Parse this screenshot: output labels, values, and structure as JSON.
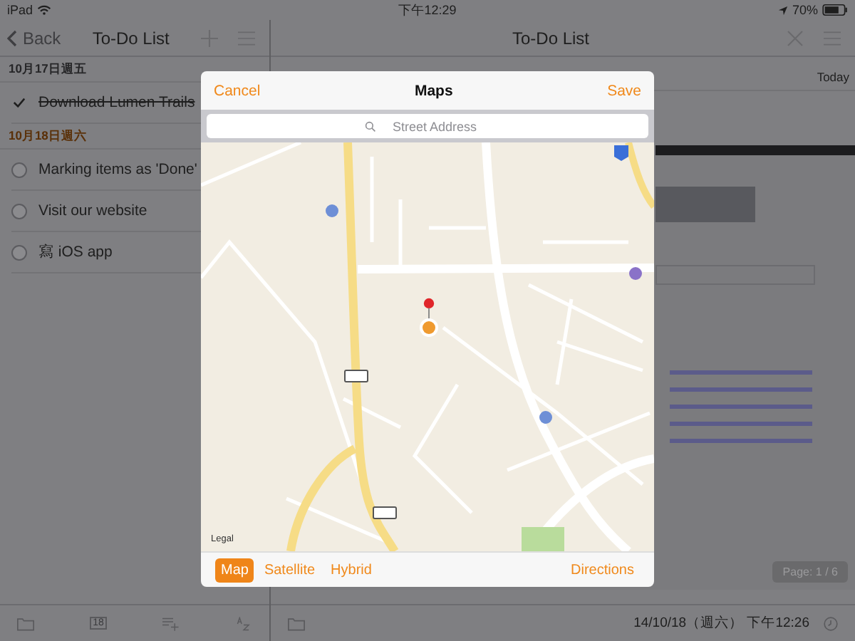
{
  "status_bar": {
    "device": "iPad",
    "time": "下午12:29",
    "battery": "70%"
  },
  "left_nav": {
    "back": "Back",
    "title": "To-Do List"
  },
  "sections": [
    {
      "date": "10月17日週五",
      "color": "#262628",
      "tasks": [
        {
          "title": "Download Lumen Trails",
          "done": true
        }
      ]
    },
    {
      "date": "10月18日週六",
      "color": "#5a3008",
      "tasks": [
        {
          "title": "Marking items as 'Done'",
          "done": false
        },
        {
          "title": "Visit our website",
          "done": false
        },
        {
          "title": "寫 iOS app",
          "done": false
        }
      ]
    }
  ],
  "left_toolbar": {
    "calendar_day": "18"
  },
  "right_nav": {
    "title": "To-Do List"
  },
  "detail": {
    "due": "Today",
    "page_badge": "Page: 1 / 6"
  },
  "right_toolbar": {
    "timestamp": "14/10/18（週六） 下午12:26"
  },
  "modal": {
    "cancel": "Cancel",
    "title": "Maps",
    "save": "Save",
    "search": {
      "placeholder": "Street Address"
    },
    "legal": "Legal",
    "map_types": [
      {
        "label": "Map",
        "selected": true
      },
      {
        "label": "Satellite",
        "selected": false
      },
      {
        "label": "Hybrid",
        "selected": false
      }
    ],
    "directions": "Directions"
  }
}
